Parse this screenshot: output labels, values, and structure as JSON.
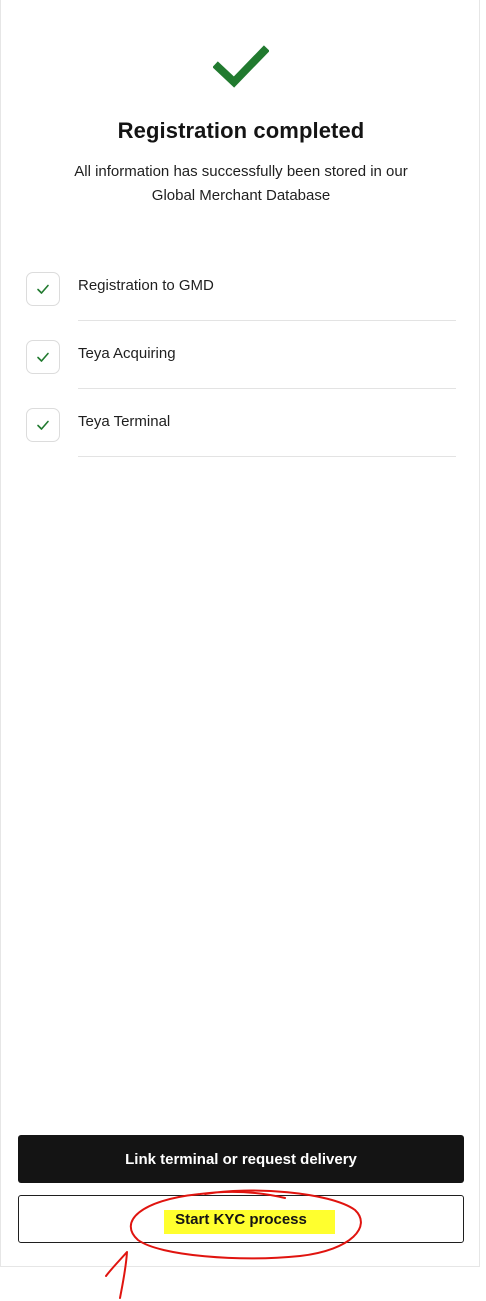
{
  "header": {
    "title": "Registration completed",
    "subtitle": "All information has successfully been stored in our Global Merchant Database"
  },
  "steps": [
    {
      "label": "Registration to GMD",
      "icon": "check-icon",
      "status": "completed"
    },
    {
      "label": "Teya Acquiring",
      "icon": "check-icon",
      "status": "completed"
    },
    {
      "label": "Teya Terminal",
      "icon": "check-icon",
      "status": "completed"
    }
  ],
  "actions": {
    "primary_label": "Link terminal or request delivery",
    "secondary_label": "Start KYC process"
  },
  "colors": {
    "success": "#217a2f",
    "primary_button": "#141414",
    "highlight": "#ffff2e",
    "annotation": "#e0140f"
  },
  "annotation": {
    "type": "hand-drawn circle and arrow",
    "target": "Start KYC process"
  }
}
